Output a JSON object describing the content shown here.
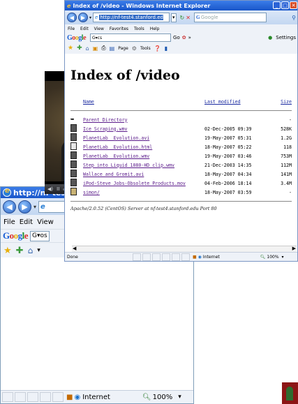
{
  "back_window": {
    "title": "http://nf-test",
    "address_partial": "e",
    "menu": [
      "File",
      "Edit",
      "View"
    ],
    "google_box": "G▾os",
    "status": {
      "zone": "Internet",
      "zoom": "100%"
    }
  },
  "video_player": {
    "controls": [
      "◀)",
      "II",
      "◀ ▮▶",
      "▾"
    ]
  },
  "front_window": {
    "title": "Index of /video - Windows Internet Explorer",
    "address": "http://nf-test4.stanford.edu/video/",
    "search_placeholder": "Google",
    "menu": [
      "File",
      "Edit",
      "View",
      "Favorites",
      "Tools",
      "Help"
    ],
    "google_label": "Google",
    "google_box": "G▾cs",
    "google_tools": "Go",
    "settings": "Settings",
    "fav_tools": [
      "Page",
      "Tools"
    ],
    "page": {
      "heading": "Index of /video",
      "columns": [
        "Name",
        "Last modified",
        "Size"
      ],
      "rows": [
        {
          "icon": "back",
          "name": "Parent Directory",
          "modified": "",
          "size": "-"
        },
        {
          "icon": "file",
          "name": "Ice_Scraping.wmv",
          "modified": "02-Dec-2005 09:39",
          "size": "528K"
        },
        {
          "icon": "file",
          "name": "PlanetLab__Evolution.avi",
          "modified": "19-May-2007 05:31",
          "size": "1.2G"
        },
        {
          "icon": "web",
          "name": "PlanetLab__Evolution.html",
          "modified": "18-May-2007 05:22",
          "size": "118"
        },
        {
          "icon": "file",
          "name": "PlanetLab__Evolution.wmv",
          "modified": "19-May-2007 03:46",
          "size": "753M"
        },
        {
          "icon": "file",
          "name": "Step_into_Liquid_1080-HD_clip.wmv",
          "modified": "21-Dec-2003 14:35",
          "size": "112M"
        },
        {
          "icon": "file",
          "name": "Wallace_and_Gromit.avi",
          "modified": "18-May-2007 04:34",
          "size": "141M"
        },
        {
          "icon": "file",
          "name": "iPod-Steve_Jobs-Obsolete_Products.mov",
          "modified": "04-Feb-2006 18:14",
          "size": "3.4M"
        },
        {
          "icon": "folder",
          "name": "simon/",
          "modified": "18-May-2007 03:59",
          "size": "-"
        }
      ],
      "address_line": "Apache/2.0.52 (CentOS) Server at nf-test4.stanford.edu Port 80"
    },
    "status": {
      "left": "Done",
      "zone": "Internet",
      "zoom": "100%"
    }
  },
  "colors": {
    "titlebar": "#1956c9",
    "link_visited": "#5a1a8a",
    "link_header": "#1a2aa0",
    "logo": "#8c1515"
  }
}
